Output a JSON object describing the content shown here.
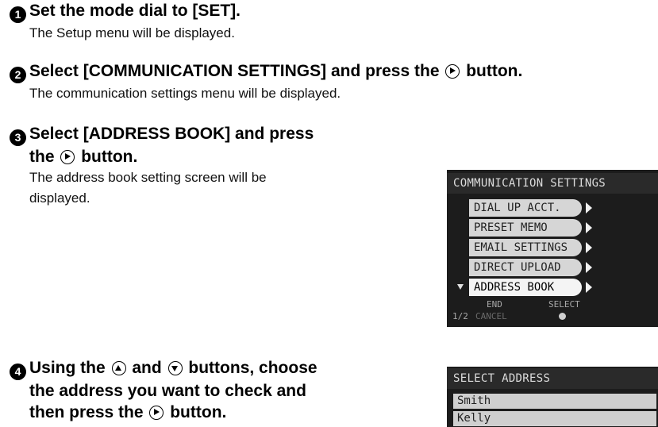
{
  "steps": [
    {
      "number": "1",
      "heading": "Set the mode dial to [SET].",
      "description": "The Setup menu will be displayed."
    },
    {
      "number": "2",
      "heading": "Select [COMMUNICATION SETTINGS] and press the",
      "heading_end": "button.",
      "description": "The communication settings menu will be displayed."
    },
    {
      "number": "3",
      "heading_line1": "Select [ADDRESS BOOK] and press",
      "heading_line2_start": "the",
      "heading_line2_end": "button.",
      "description_line1": "The address book setting screen will be",
      "description_line2": "displayed."
    },
    {
      "number": "4",
      "heading_line1_start": "Using the",
      "heading_line1_mid": "and",
      "heading_line1_end": "buttons, choose",
      "heading_line2": "the address you want to check and",
      "heading_line3_start": "then press the",
      "heading_line3_end": "button."
    }
  ],
  "comm_screen": {
    "title": "COMMUNICATION SETTINGS",
    "items": [
      "DIAL UP ACCT.",
      "PRESET MEMO",
      "EMAIL SETTINGS",
      "DIRECT UPLOAD",
      "ADDRESS BOOK"
    ],
    "selected_index": 4,
    "footer": {
      "page": "1/2",
      "end": "END",
      "cancel": "CANCEL",
      "select": "SELECT"
    }
  },
  "addr_screen": {
    "title": "SELECT ADDRESS",
    "rows": [
      "Smith",
      "Kelly"
    ]
  },
  "icons": {
    "right": "right-button-icon",
    "up": "up-button-icon",
    "down": "down-button-icon"
  }
}
